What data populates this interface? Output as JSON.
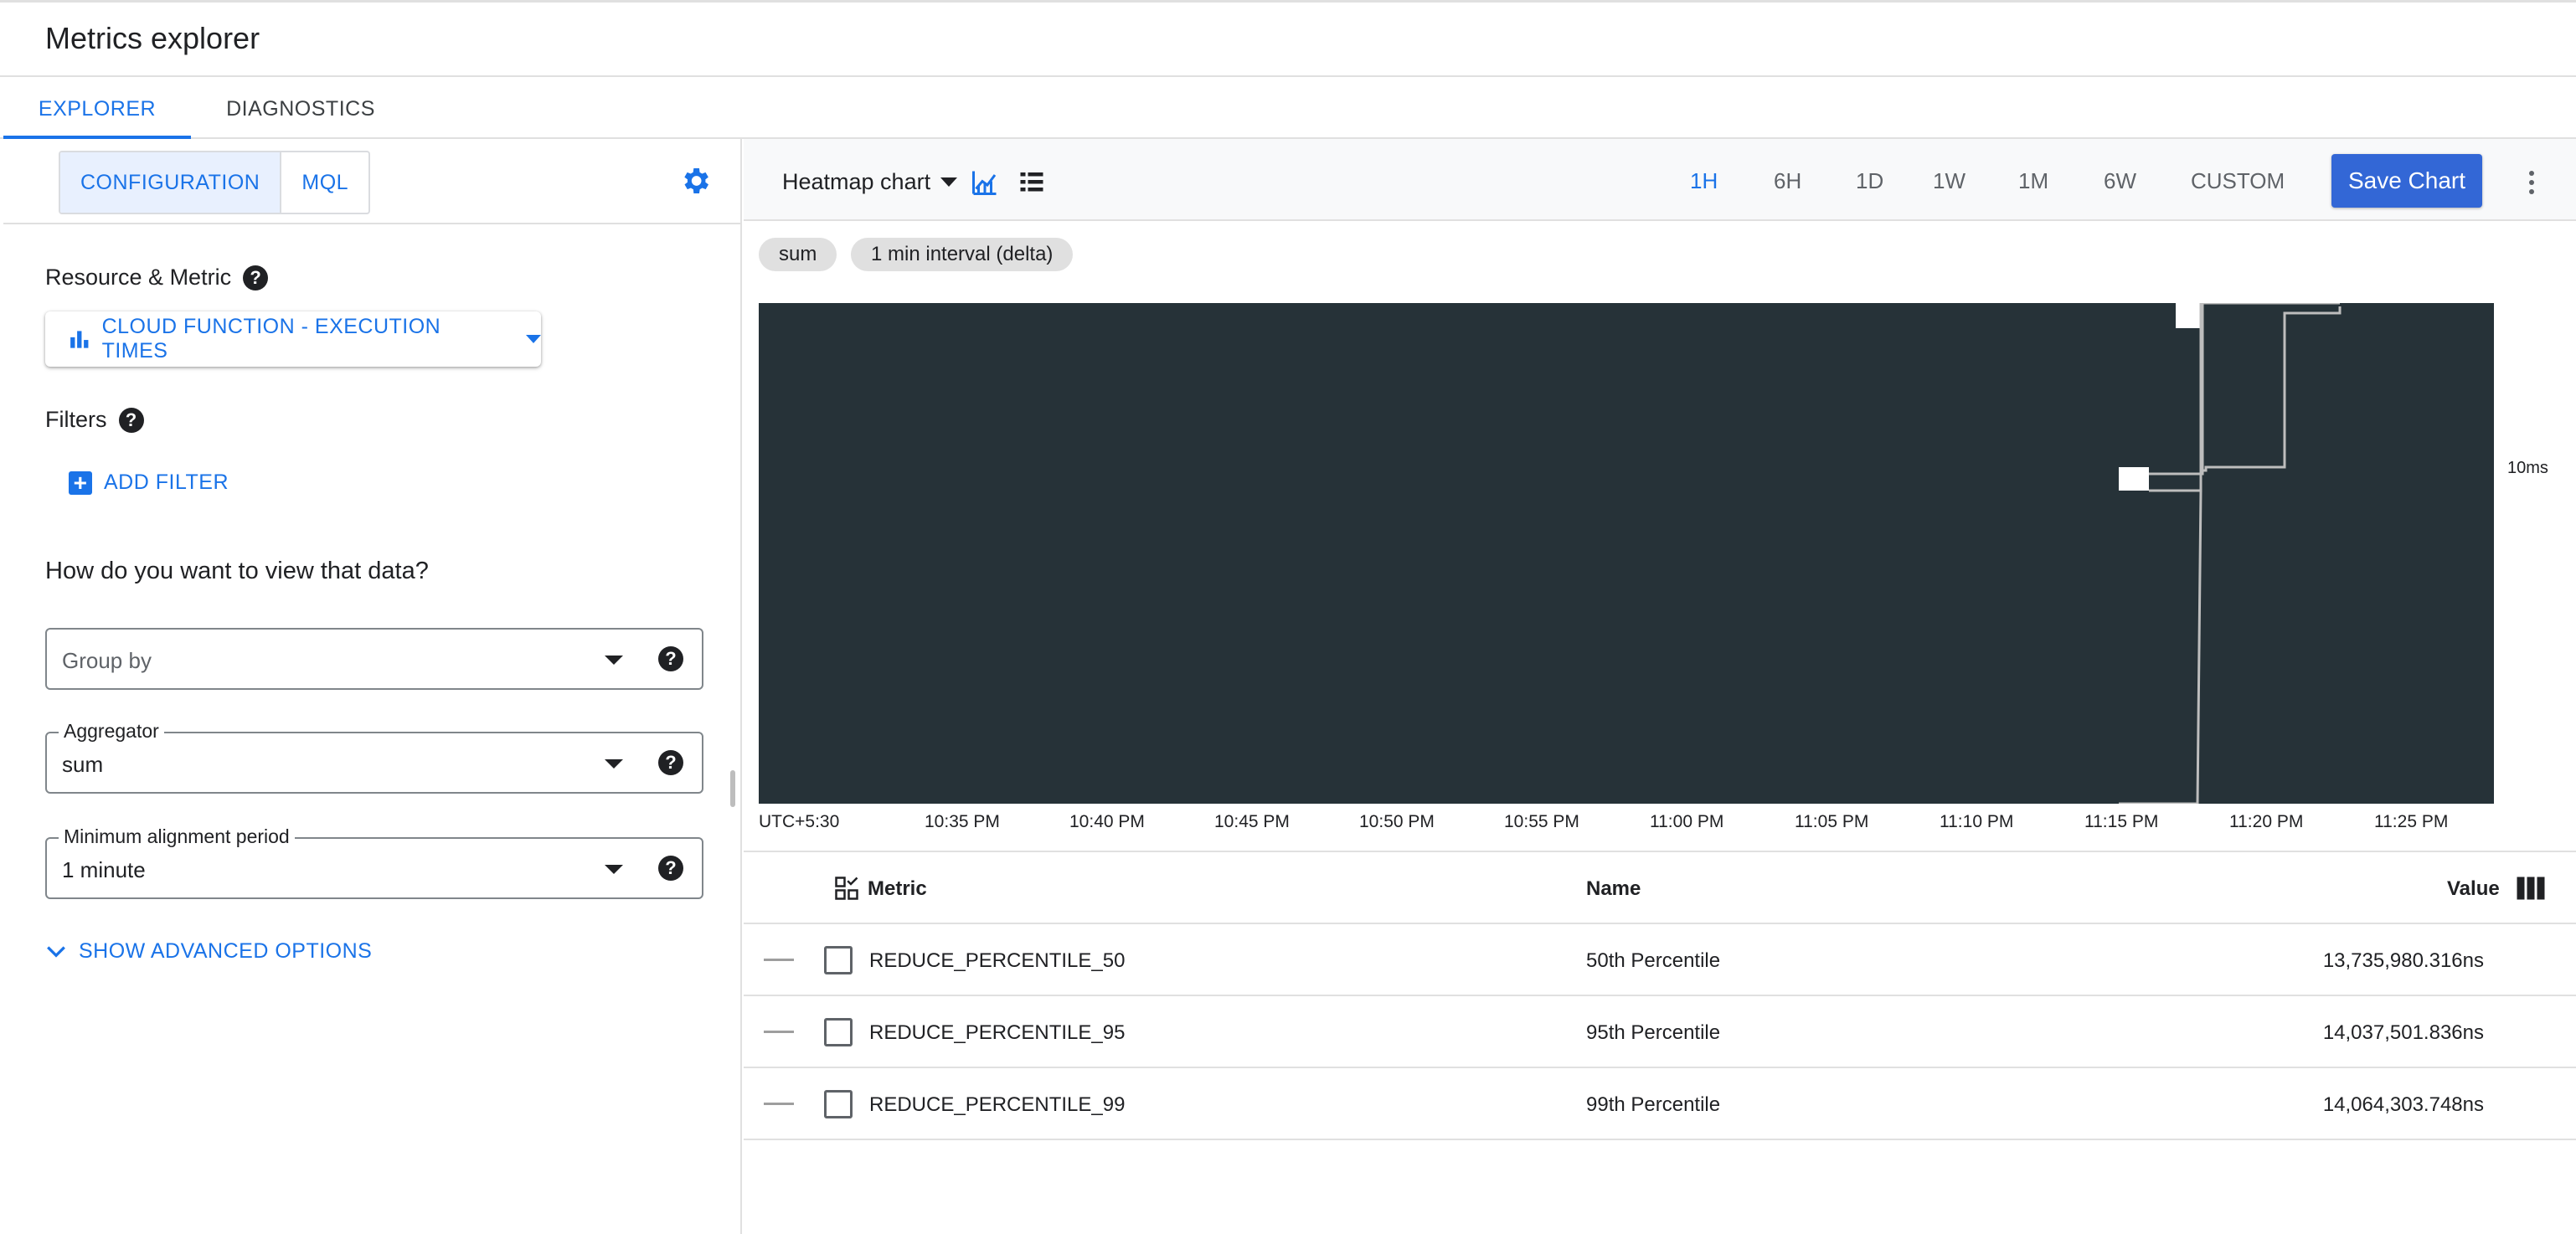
{
  "app": {
    "title": "Metrics explorer"
  },
  "tabs": [
    {
      "label": "EXPLORER",
      "active": true
    },
    {
      "label": "DIAGNOSTICS",
      "active": false
    }
  ],
  "left": {
    "segments": [
      {
        "label": "CONFIGURATION",
        "active": true
      },
      {
        "label": "MQL",
        "active": false
      }
    ],
    "settings_icon": "gear-icon",
    "resource_metric": {
      "label": "Resource & Metric",
      "selected": "CLOUD FUNCTION - EXECUTION TIMES",
      "icon": "bar-chart-icon"
    },
    "filters": {
      "label": "Filters",
      "add_label": "ADD FILTER"
    },
    "view_heading": "How do you want to view that data?",
    "group_by": {
      "placeholder": "Group by",
      "value": ""
    },
    "aggregator": {
      "label": "Aggregator",
      "value": "sum"
    },
    "alignment": {
      "label": "Minimum alignment period",
      "value": "1 minute"
    },
    "advanced_label": "SHOW ADVANCED OPTIONS",
    "help_glyph": "?"
  },
  "toolbar": {
    "chart_type": "Heatmap chart",
    "ranges": [
      "1H",
      "6H",
      "1D",
      "1W",
      "1M",
      "6W",
      "CUSTOM"
    ],
    "active_range": "1H",
    "save_label": "Save Chart"
  },
  "chips": [
    "sum",
    "1 min interval (delta)"
  ],
  "chart_data": {
    "type": "heatmap",
    "x_ticks": [
      "UTC+5:30",
      "10:35 PM",
      "10:40 PM",
      "10:45 PM",
      "10:50 PM",
      "10:55 PM",
      "11:00 PM",
      "11:05 PM",
      "11:10 PM",
      "11:15 PM",
      "11:20 PM",
      "11:25 PM"
    ],
    "y_tick": "10ms",
    "background_color": "#263238",
    "line_color": "#bdbdbd",
    "cell_color": "#ffffff"
  },
  "table": {
    "columns": {
      "metric": "Metric",
      "name": "Name",
      "value": "Value"
    },
    "rows": [
      {
        "metric": "REDUCE_PERCENTILE_50",
        "name": "50th Percentile",
        "value": "13,735,980.316ns"
      },
      {
        "metric": "REDUCE_PERCENTILE_95",
        "name": "95th Percentile",
        "value": "14,037,501.836ns"
      },
      {
        "metric": "REDUCE_PERCENTILE_99",
        "name": "99th Percentile",
        "value": "14,064,303.748ns"
      }
    ]
  },
  "colors": {
    "accent": "#1a73e8",
    "save_button": "#3367d6"
  }
}
